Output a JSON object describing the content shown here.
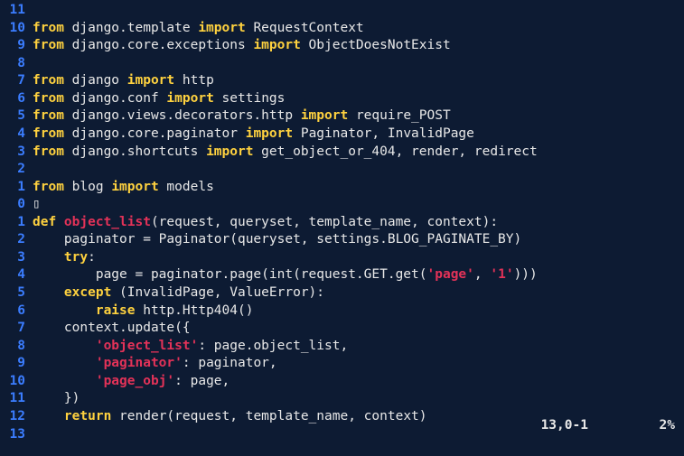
{
  "editor": {
    "filetype": "python",
    "cursor_position": "13,0-1",
    "scroll_percent": "2%",
    "lines": [
      {
        "rel": "11",
        "tokens": [
          {
            "t": "plain",
            "v": ""
          }
        ]
      },
      {
        "rel": "10",
        "tokens": [
          {
            "t": "kw-from",
            "v": "from"
          },
          {
            "t": "plain",
            "v": " django.template "
          },
          {
            "t": "kw-import",
            "v": "import"
          },
          {
            "t": "plain",
            "v": " RequestContext"
          }
        ]
      },
      {
        "rel": "9",
        "tokens": [
          {
            "t": "kw-from",
            "v": "from"
          },
          {
            "t": "plain",
            "v": " django.core.exceptions "
          },
          {
            "t": "kw-import",
            "v": "import"
          },
          {
            "t": "plain",
            "v": " ObjectDoesNotExist"
          }
        ]
      },
      {
        "rel": "8",
        "tokens": [
          {
            "t": "plain",
            "v": ""
          }
        ]
      },
      {
        "rel": "7",
        "tokens": [
          {
            "t": "kw-from",
            "v": "from"
          },
          {
            "t": "plain",
            "v": " django "
          },
          {
            "t": "kw-import",
            "v": "import"
          },
          {
            "t": "plain",
            "v": " http"
          }
        ]
      },
      {
        "rel": "6",
        "tokens": [
          {
            "t": "kw-from",
            "v": "from"
          },
          {
            "t": "plain",
            "v": " django.conf "
          },
          {
            "t": "kw-import",
            "v": "import"
          },
          {
            "t": "plain",
            "v": " settings"
          }
        ]
      },
      {
        "rel": "5",
        "tokens": [
          {
            "t": "kw-from",
            "v": "from"
          },
          {
            "t": "plain",
            "v": " django.views.decorators.http "
          },
          {
            "t": "kw-import",
            "v": "import"
          },
          {
            "t": "plain",
            "v": " require_POST"
          }
        ]
      },
      {
        "rel": "4",
        "tokens": [
          {
            "t": "kw-from",
            "v": "from"
          },
          {
            "t": "plain",
            "v": " django.core.paginator "
          },
          {
            "t": "kw-import",
            "v": "import"
          },
          {
            "t": "plain",
            "v": " Paginator, InvalidPage"
          }
        ]
      },
      {
        "rel": "3",
        "tokens": [
          {
            "t": "kw-from",
            "v": "from"
          },
          {
            "t": "plain",
            "v": " django.shortcuts "
          },
          {
            "t": "kw-import",
            "v": "import"
          },
          {
            "t": "plain",
            "v": " get_object_or_404, render, redirect"
          }
        ]
      },
      {
        "rel": "2",
        "tokens": [
          {
            "t": "plain",
            "v": ""
          }
        ]
      },
      {
        "rel": "1",
        "tokens": [
          {
            "t": "kw-from",
            "v": "from"
          },
          {
            "t": "plain",
            "v": " blog "
          },
          {
            "t": "kw-import",
            "v": "import"
          },
          {
            "t": "plain",
            "v": " models"
          }
        ]
      },
      {
        "rel": "0",
        "tokens": [
          {
            "t": "cursor-box",
            "v": "▯"
          }
        ]
      },
      {
        "rel": "1",
        "tokens": [
          {
            "t": "kw-import",
            "v": "def "
          },
          {
            "t": "func",
            "v": "object_list"
          },
          {
            "t": "plain",
            "v": "(request, queryset, template_name, context):"
          }
        ]
      },
      {
        "rel": "2",
        "tokens": [
          {
            "t": "plain",
            "v": "    paginator = Paginator(queryset, settings.BLOG_PAGINATE_BY)"
          }
        ]
      },
      {
        "rel": "3",
        "tokens": [
          {
            "t": "plain",
            "v": "    "
          },
          {
            "t": "kw-import",
            "v": "try"
          },
          {
            "t": "plain",
            "v": ":"
          }
        ]
      },
      {
        "rel": "4",
        "tokens": [
          {
            "t": "plain",
            "v": "        page = paginator.page(int(request.GET.get("
          },
          {
            "t": "str",
            "v": "'page'"
          },
          {
            "t": "plain",
            "v": ", "
          },
          {
            "t": "str",
            "v": "'1'"
          },
          {
            "t": "plain",
            "v": ")))"
          }
        ]
      },
      {
        "rel": "5",
        "tokens": [
          {
            "t": "plain",
            "v": "    "
          },
          {
            "t": "kw-import",
            "v": "except"
          },
          {
            "t": "plain",
            "v": " (InvalidPage, ValueError):"
          }
        ]
      },
      {
        "rel": "6",
        "tokens": [
          {
            "t": "plain",
            "v": "        "
          },
          {
            "t": "kw-import",
            "v": "raise"
          },
          {
            "t": "plain",
            "v": " http.Http404()"
          }
        ]
      },
      {
        "rel": "7",
        "tokens": [
          {
            "t": "plain",
            "v": "    context.update({"
          }
        ]
      },
      {
        "rel": "8",
        "tokens": [
          {
            "t": "plain",
            "v": "        "
          },
          {
            "t": "str",
            "v": "'object_list'"
          },
          {
            "t": "plain",
            "v": ": page.object_list,"
          }
        ]
      },
      {
        "rel": "9",
        "tokens": [
          {
            "t": "plain",
            "v": "        "
          },
          {
            "t": "str",
            "v": "'paginator'"
          },
          {
            "t": "plain",
            "v": ": paginator,"
          }
        ]
      },
      {
        "rel": "10",
        "tokens": [
          {
            "t": "plain",
            "v": "        "
          },
          {
            "t": "str",
            "v": "'page_obj'"
          },
          {
            "t": "plain",
            "v": ": page,"
          }
        ]
      },
      {
        "rel": "11",
        "tokens": [
          {
            "t": "plain",
            "v": "    })"
          }
        ]
      },
      {
        "rel": "12",
        "tokens": [
          {
            "t": "plain",
            "v": "    "
          },
          {
            "t": "kw-import",
            "v": "return"
          },
          {
            "t": "plain",
            "v": " render(request, template_name, context)"
          }
        ]
      },
      {
        "rel": "13",
        "tokens": [
          {
            "t": "plain",
            "v": ""
          }
        ]
      }
    ]
  }
}
